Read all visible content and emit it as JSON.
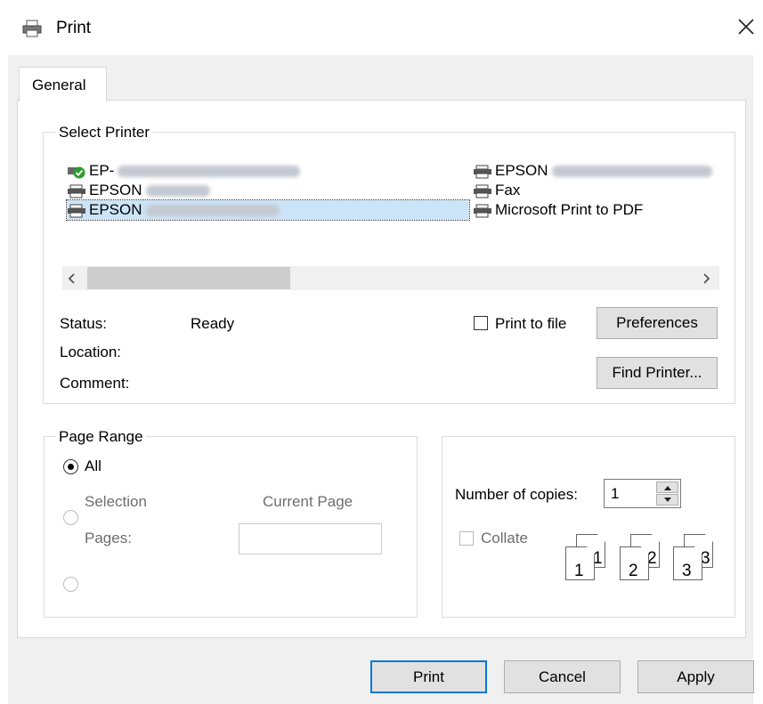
{
  "window": {
    "title": "Print",
    "tab": "General"
  },
  "select_printer": {
    "legend": "Select Printer",
    "printers_left": [
      {
        "prefix": "EP-",
        "hidden": "879A Series(Network)",
        "icon": "network-printer-check-icon",
        "selected": false
      },
      {
        "prefix": "EPSON",
        "hidden": "FX-890",
        "icon": "printer-icon",
        "selected": false
      },
      {
        "prefix": "EPSON",
        "hidden": "FX-890II ESC/P",
        "icon": "printer-icon",
        "selected": true
      }
    ],
    "printers_right": [
      {
        "prefix": "EPSON",
        "hidden": "XP-830 Series (FA",
        "icon": "printer-icon"
      },
      {
        "prefix": "Fax",
        "hidden": "",
        "icon": "fax-icon"
      },
      {
        "prefix": "Microsoft Print to PDF",
        "hidden": "",
        "icon": "printer-icon"
      }
    ],
    "status_label": "Status:",
    "status_value": "Ready",
    "location_label": "Location:",
    "comment_label": "Comment:",
    "print_to_file": "Print to file",
    "preferences": "Preferences",
    "find_printer": "Find Printer..."
  },
  "page_range": {
    "legend": "Page Range",
    "all": "All",
    "selection": "Selection",
    "current_page": "Current Page",
    "pages": "Pages:"
  },
  "copies": {
    "label": "Number of copies:",
    "value": "1",
    "collate": "Collate",
    "page_icons": [
      "1",
      "1",
      "2",
      "2",
      "3",
      "3"
    ]
  },
  "buttons": {
    "print": "Print",
    "cancel": "Cancel",
    "apply": "Apply"
  },
  "colors": {
    "selection": "#cce4f7",
    "default_button_border": "#0078d7",
    "dialog_bg": "#f0f0f0"
  }
}
